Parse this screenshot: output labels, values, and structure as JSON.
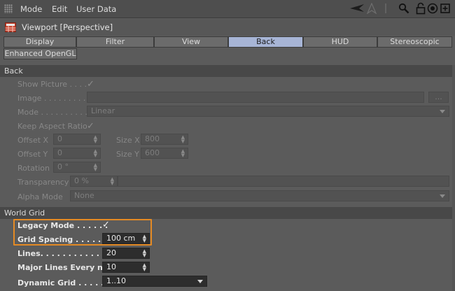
{
  "menu": {
    "mode": "Mode",
    "edit": "Edit",
    "user_data": "User Data"
  },
  "window": {
    "title": "Viewport [Perspective]"
  },
  "tabs": {
    "display": "Display",
    "filter": "Filter",
    "view": "View",
    "back": "Back",
    "hud": "HUD",
    "stereoscopic": "Stereoscopic",
    "enhanced_opengl": "Enhanced OpenGL",
    "active": "Back"
  },
  "back": {
    "header": "Back",
    "show_picture_label": "Show Picture . . . .",
    "show_picture_checked": true,
    "image_label": "Image . . . . . . . . . .",
    "image_value": "",
    "browse_label": "...",
    "mode_label": "Mode . . . . . . . . . . .",
    "mode_value": "Linear",
    "keep_aspect_label": "Keep Aspect Ratio",
    "keep_aspect_checked": true,
    "offset_x_label": "Offset X",
    "offset_x_value": "0",
    "offset_y_label": "Offset Y",
    "offset_y_value": "0",
    "size_x_label": "Size X",
    "size_x_value": "800",
    "size_y_label": "Size Y",
    "size_y_value": "600",
    "rotation_label": "Rotation",
    "rotation_value": "0 °",
    "transparency_label": "Transparency",
    "transparency_value": "0 %",
    "alpha_mode_label": "Alpha Mode",
    "alpha_mode_value": "None"
  },
  "world_grid": {
    "header": "World Grid",
    "legacy_mode_label": "Legacy Mode . . . . . .",
    "legacy_mode_checked": true,
    "grid_spacing_label": "Grid Spacing . . . . . . . .",
    "grid_spacing_value": "100 cm",
    "lines_label": "Lines. . . . . . . . . . . . . . . .",
    "lines_value": "20",
    "major_lines_label": "Major Lines Every nth",
    "major_lines_value": "10",
    "dynamic_grid_label": "Dynamic Grid . . . . . . .",
    "dynamic_grid_value": "1..10"
  },
  "colors": {
    "active_tab": "#a7b5d6",
    "highlight": "#e48a24",
    "section_bg": "#484848"
  },
  "icons": [
    "grip-icon",
    "arrow-left-icon",
    "arrow-up-icon",
    "search-icon",
    "lock-icon",
    "target-icon",
    "new-window-icon",
    "viewport-icon",
    "checkmark-icon"
  ]
}
